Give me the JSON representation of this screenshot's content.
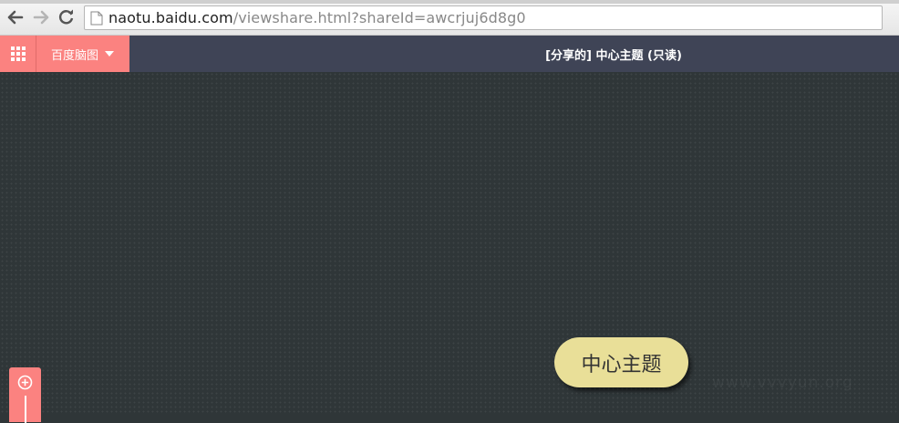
{
  "browser": {
    "url_host": "naotu.baidu.com",
    "url_path": "/viewshare.html?shareId=awcrjuj6d8g0"
  },
  "app": {
    "brand_label": "百度脑图",
    "doc_title": "[分享的] 中心主题 (只读)"
  },
  "canvas": {
    "central_topic": "中心主题",
    "watermark": "www.vvvyun.org"
  },
  "icons": {
    "back": "back-arrow-icon",
    "forward": "forward-arrow-icon",
    "reload": "reload-icon",
    "page": "page-icon",
    "apps": "apps-grid-icon",
    "caret": "caret-down-icon",
    "zoom_in": "zoom-in-icon"
  },
  "colors": {
    "accent": "#fb8280",
    "header": "#3f4456",
    "canvas": "#2f3638",
    "topic": "#e9df98"
  }
}
